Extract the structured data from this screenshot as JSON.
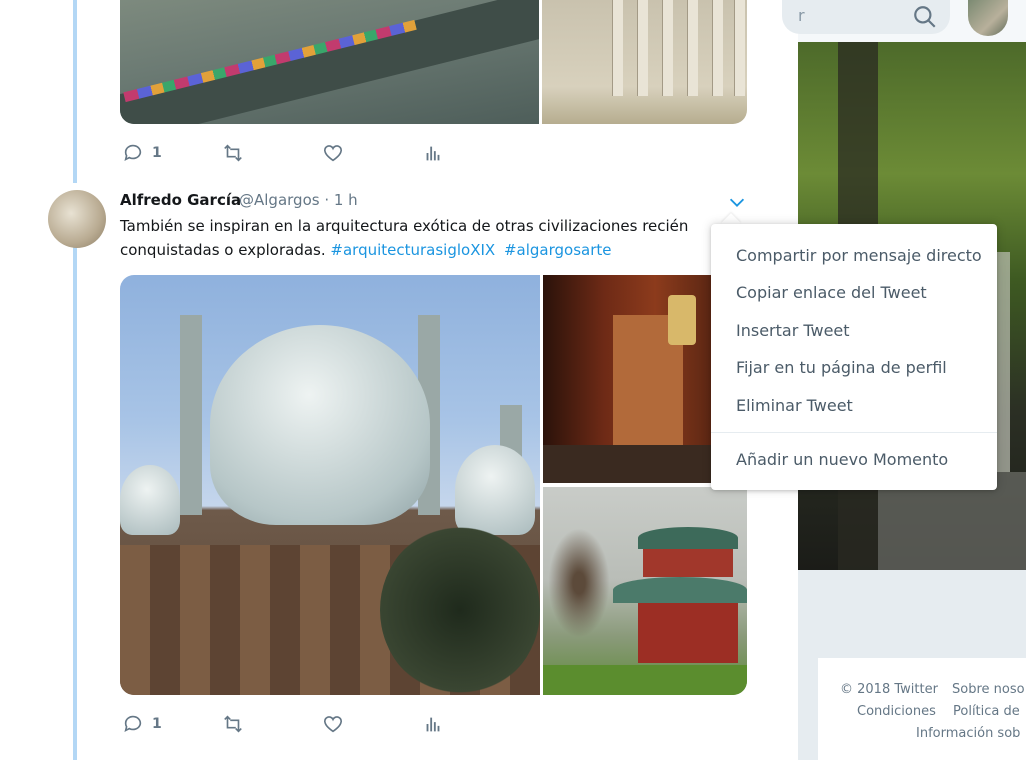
{
  "header": {
    "search_placeholder_fragment": "r",
    "search_icon": "search-icon"
  },
  "tweet1": {
    "actions": {
      "reply_count": "1",
      "retweet_count": "",
      "like_count": ""
    }
  },
  "tweet2": {
    "author_name": "Alfredo García",
    "handle_time": "@Algargos · 1 h",
    "text_line1": "También se inspiran en la arquitectura exótica de otras civilizaciones recién",
    "text_line2_plain": "conquistadas o exploradas.",
    "hashtag1": "#arquitecturasigloXIX",
    "hashtag2": "#algargosarte",
    "actions": {
      "reply_count": "1",
      "retweet_count": "",
      "like_count": ""
    }
  },
  "menu": {
    "items": [
      "Compartir por mensaje directo",
      "Copiar enlace del Tweet",
      "Insertar Tweet",
      "Fijar en tu página de perfil",
      "Eliminar Tweet",
      "Añadir un nuevo Momento"
    ]
  },
  "footer": {
    "line1_a": "© 2018 Twitter",
    "line1_b": "Sobre noso",
    "line2_a": "Condiciones",
    "line2_b": "Política de",
    "line3": "Información sob"
  },
  "colors": {
    "link": "#1b95e0",
    "thread_line": "#b3d7f5",
    "muted_text": "#657786"
  }
}
